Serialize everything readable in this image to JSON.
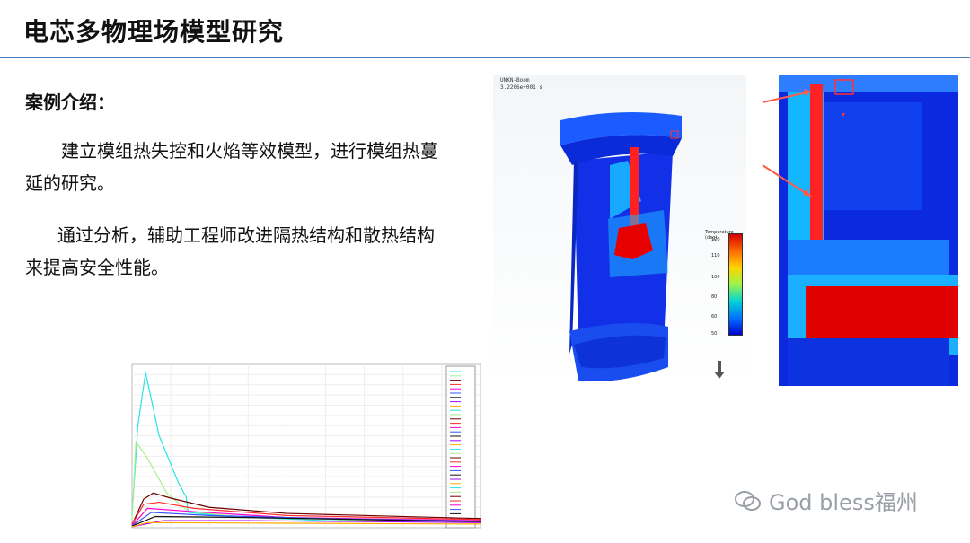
{
  "slide": {
    "title": "电芯多物理场模型研究",
    "subhead": "案例介绍：",
    "paragraphs": [
      "建立模组热失控和火焰等效模型，进行模组热蔓延的研究。",
      "通过分析，辅助工程师改进隔热结构和散热结构来提高安全性能。"
    ]
  },
  "simulation": {
    "header_line1": "UNKN-Boom",
    "header_line2": "3.2206e+001 s",
    "legend_title": "Temperature (deg)",
    "legend_ticks": [
      "120",
      "110",
      "100",
      "80",
      "60",
      "50"
    ],
    "colors": {
      "hot": "#e00000",
      "cold": "#0033e6",
      "mid": "#00c8ff",
      "arrow": "#ff5a4a"
    }
  },
  "chart_data": {
    "type": "line",
    "xlim": [
      0,
      900
    ],
    "ylim": [
      0,
      800
    ],
    "series": [
      {
        "color": "#27e3e3",
        "values": [
          [
            0,
            60
          ],
          [
            15,
            500
          ],
          [
            35,
            760
          ],
          [
            70,
            450
          ],
          [
            120,
            220
          ],
          [
            140,
            150
          ],
          [
            145,
            75
          ],
          [
            250,
            55
          ],
          [
            500,
            35
          ],
          [
            900,
            28
          ]
        ]
      },
      {
        "color": "#a7ef8a",
        "values": [
          [
            0,
            40
          ],
          [
            10,
            420
          ],
          [
            40,
            340
          ],
          [
            90,
            170
          ],
          [
            145,
            80
          ],
          [
            300,
            50
          ],
          [
            900,
            25
          ]
        ]
      },
      {
        "color": "#6b0000",
        "values": [
          [
            0,
            15
          ],
          [
            30,
            140
          ],
          [
            55,
            170
          ],
          [
            100,
            145
          ],
          [
            200,
            100
          ],
          [
            400,
            70
          ],
          [
            900,
            45
          ]
        ]
      },
      {
        "color": "#ff2a2a",
        "values": [
          [
            0,
            15
          ],
          [
            30,
            115
          ],
          [
            70,
            125
          ],
          [
            160,
            95
          ],
          [
            400,
            60
          ],
          [
            900,
            40
          ]
        ]
      },
      {
        "color": "#ff00d0",
        "values": [
          [
            0,
            10
          ],
          [
            40,
            95
          ],
          [
            150,
            80
          ],
          [
            400,
            50
          ],
          [
            900,
            35
          ]
        ]
      },
      {
        "color": "#3355ff",
        "values": [
          [
            0,
            10
          ],
          [
            50,
            75
          ],
          [
            200,
            60
          ],
          [
            500,
            45
          ],
          [
            900,
            32
          ]
        ]
      },
      {
        "color": "#111111",
        "values": [
          [
            0,
            8
          ],
          [
            60,
            55
          ],
          [
            300,
            50
          ],
          [
            900,
            30
          ]
        ]
      },
      {
        "color": "#aa00ff",
        "values": [
          [
            0,
            5
          ],
          [
            80,
            35
          ],
          [
            300,
            35
          ],
          [
            900,
            25
          ]
        ]
      },
      {
        "color": "#ffaa00",
        "values": [
          [
            0,
            5
          ],
          [
            40,
            25
          ],
          [
            400,
            22
          ],
          [
            900,
            18
          ]
        ]
      }
    ]
  },
  "watermark": {
    "text": "God bless福州",
    "icon": "wechat-icon"
  }
}
